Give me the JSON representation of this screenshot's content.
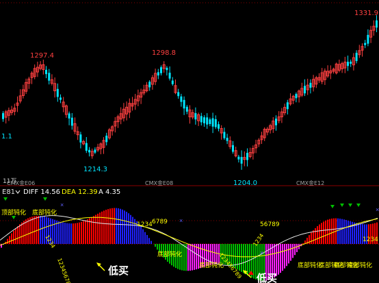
{
  "price_panel": {
    "high_labels": [
      "1297.4",
      "1298.8",
      "1331.9"
    ],
    "low_labels": [
      "1214.3",
      "1204.0",
      "1.1"
    ],
    "volume_label": "11万",
    "contract_labels": [
      "CMX金E06",
      "CMX金E08",
      "CMX金E12"
    ]
  },
  "indicator_bar": {
    "name": "E81",
    "dropdown_icon": "chevron-down-icon",
    "diff_label": "DIFF 14.56",
    "dea_label": "DEA 12.39",
    "a_label": "A 4.35"
  },
  "annotations": {
    "bottom_signals": [
      "底部钝化",
      "底部钝化",
      "底部钝化",
      "底部钝化",
      "底部钝化",
      "底部钝化"
    ],
    "top_signals": [
      "顶部钝化",
      "底部钝化"
    ],
    "buy_signals": [
      "低买",
      "低买"
    ],
    "count_sequences": [
      "123456789",
      "123456789",
      "1234",
      "6789",
      "1234",
      "56789",
      "1234",
      "1234"
    ]
  },
  "colors": {
    "up": "#ff4040",
    "down": "#00e5ff",
    "bar_red": "#ff0000",
    "bar_blue": "#2020ff",
    "bar_green": "#00c000",
    "bar_magenta": "#ff20ff",
    "diff_line": "#e8e8e8",
    "dea_line": "#ffff00",
    "label_yellow": "#ffff00",
    "label_red": "#ff4040",
    "label_cyan": "#00e5ff",
    "grid": "#8b0000"
  }
}
